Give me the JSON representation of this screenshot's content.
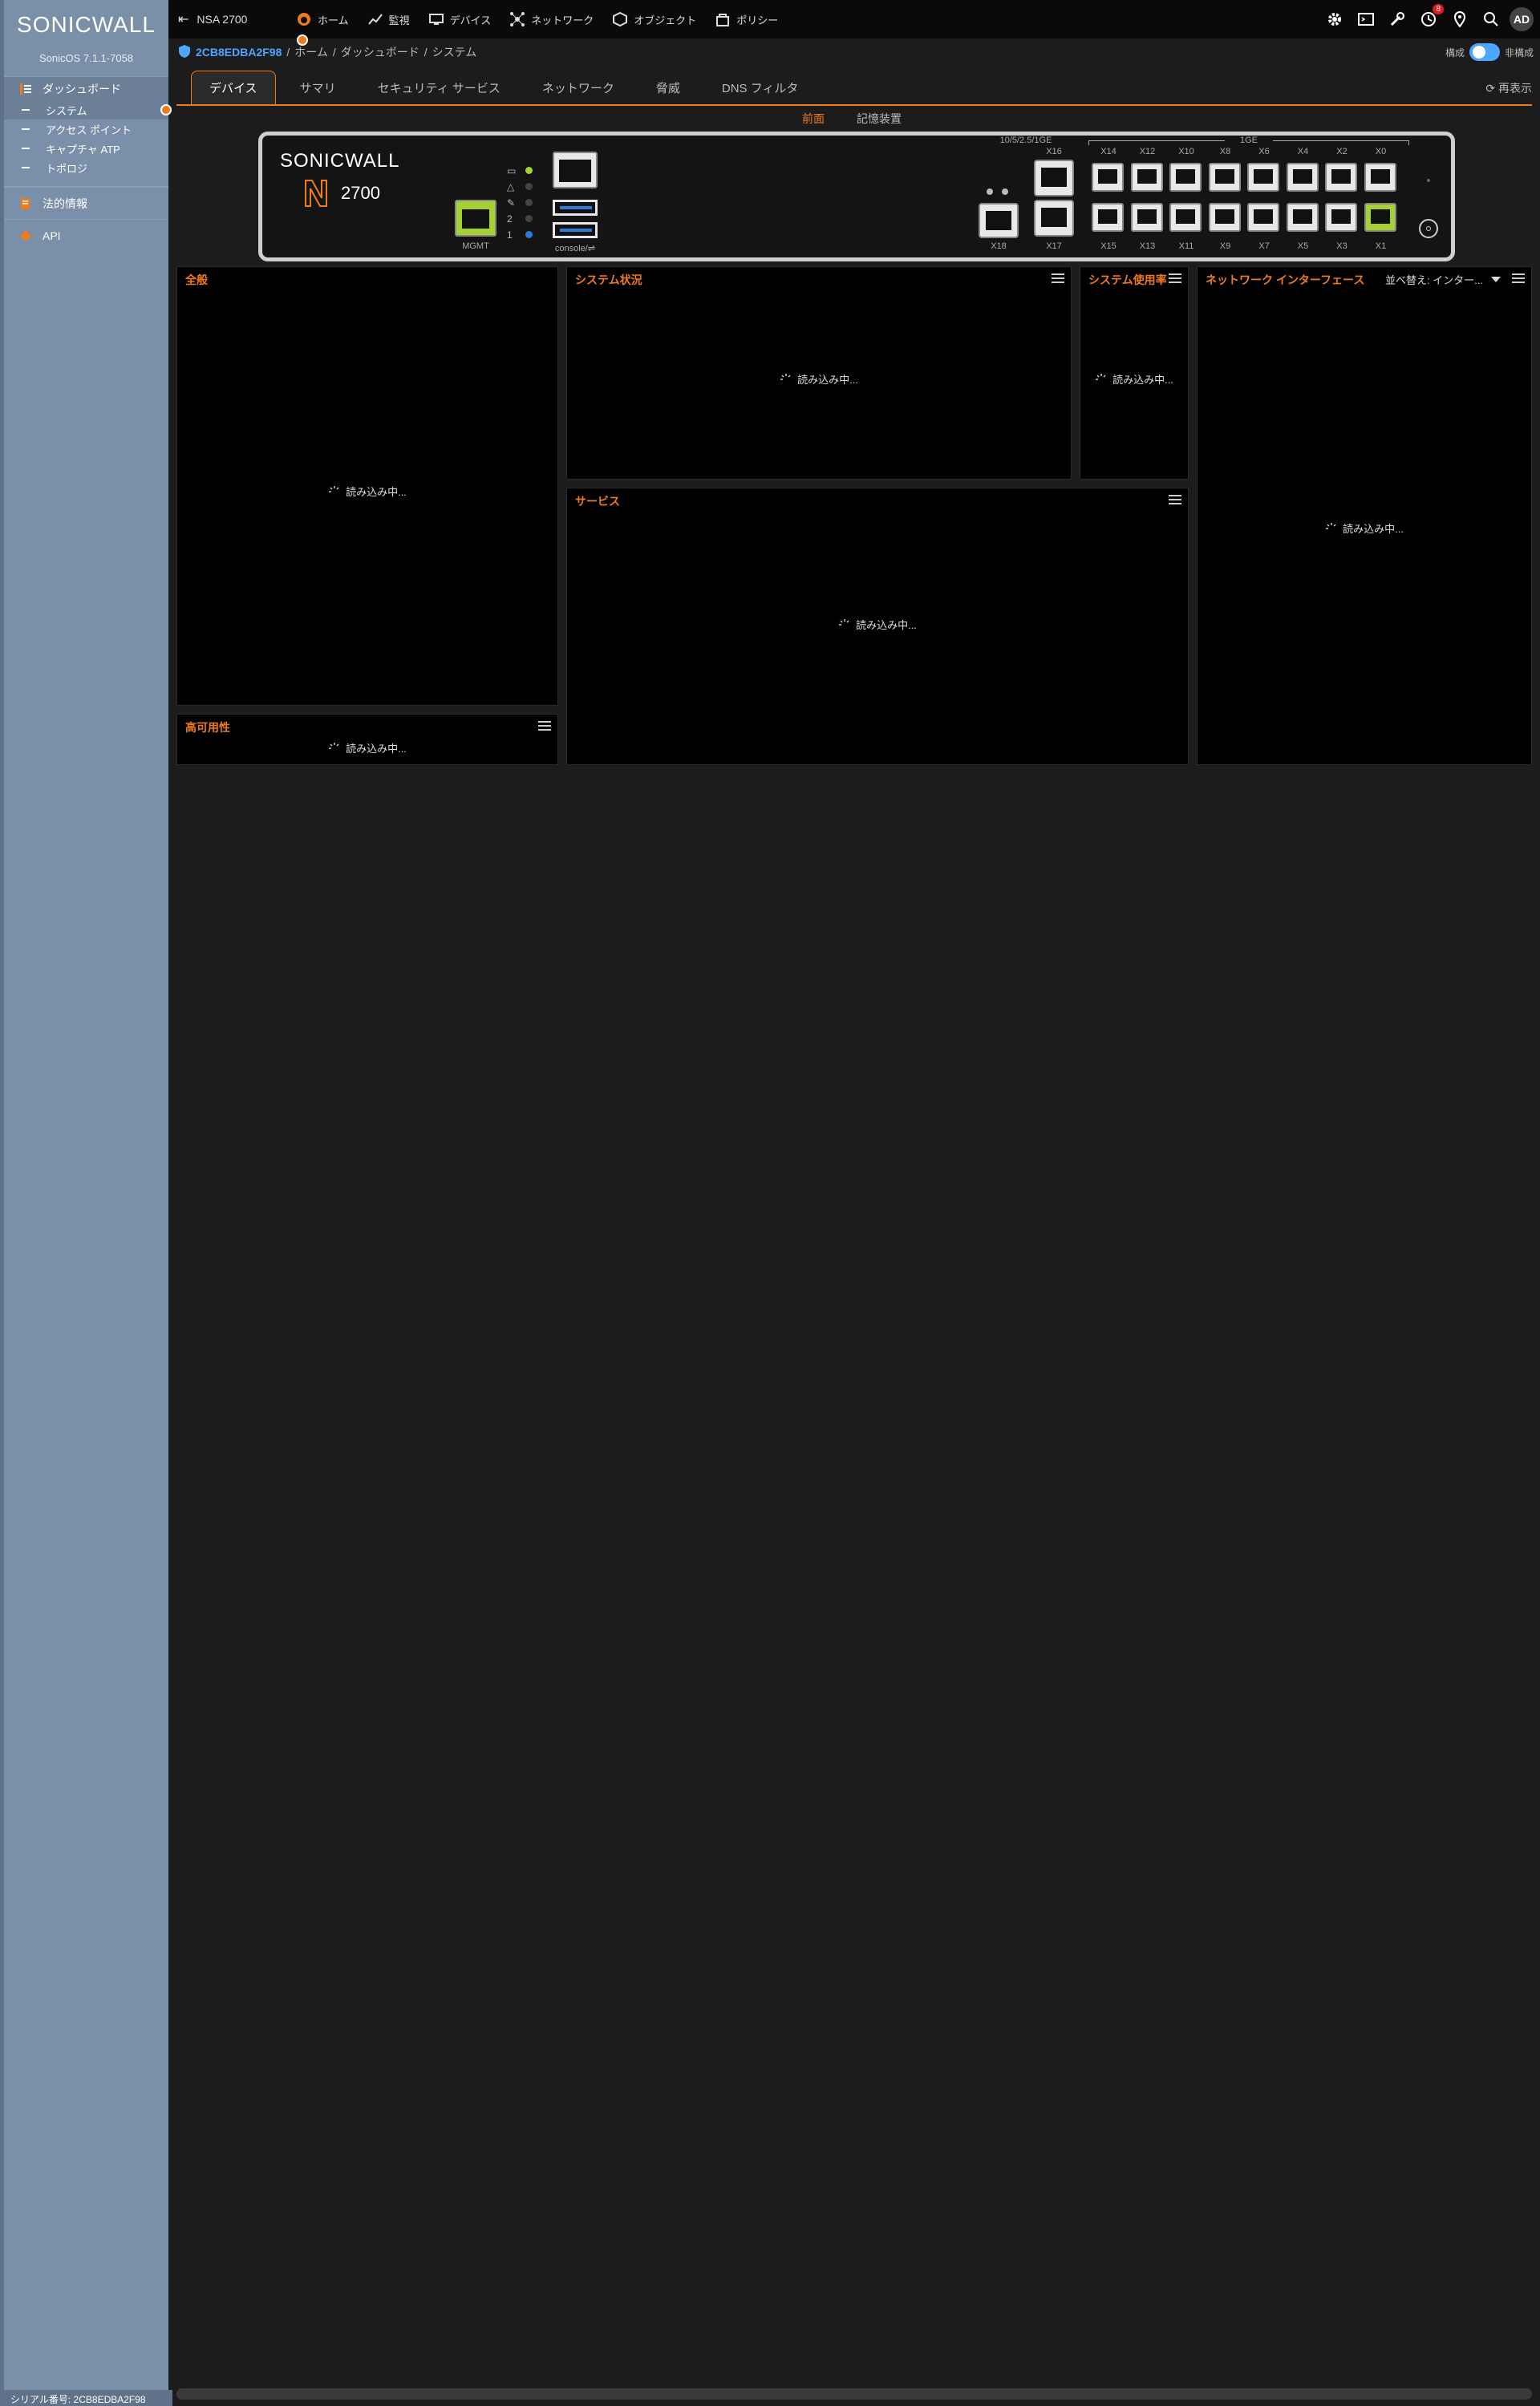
{
  "sidebar": {
    "logo": "SONICWALL",
    "version": "SonicOS 7.1.1-7058",
    "sections": [
      {
        "label": "ダッシュボード",
        "icon": "dashboard-icon"
      },
      {
        "label": "法的情報",
        "icon": "legal-icon"
      },
      {
        "label": "API",
        "icon": "api-icon"
      }
    ],
    "dashboard_items": [
      "システム",
      "アクセス ポイント",
      "キャプチャ ATP",
      "トポロジ"
    ],
    "active_item": "システム",
    "serial": "シリアル番号: 2CB8EDBA2F98"
  },
  "topbar": {
    "device_name": "NSA 2700",
    "nav": [
      "ホーム",
      "監視",
      "デバイス",
      "ネットワーク",
      "オブジェクト",
      "ポリシー"
    ],
    "notification_count": "8",
    "avatar": "AD"
  },
  "breadcrumb": {
    "serial": "2CB8EDBA2F98",
    "path": [
      "ホーム",
      "ダッシュボード",
      "システム"
    ],
    "toggle_left": "構成",
    "toggle_right": "非構成"
  },
  "tabs": [
    "デバイス",
    "サマリ",
    "セキュリティ サービス",
    "ネットワーク",
    "脅威",
    "DNS フィルタ"
  ],
  "refresh_label": "再表示",
  "subtabs": [
    "前面",
    "記憶装置"
  ],
  "device": {
    "brand": "SONICWALL",
    "model": "2700",
    "mgmt_label": "MGMT",
    "console_label": "console/",
    "led_labels": [
      "2",
      "1"
    ],
    "sfp_group_label": "10/5/2.5/1GE",
    "rj_group_label": "1GE",
    "top_ports": [
      "X14",
      "X12",
      "X10",
      "X8",
      "X6",
      "X4",
      "X2",
      "X0"
    ],
    "bottom_ports": [
      "X15",
      "X13",
      "X11",
      "X9",
      "X7",
      "X5",
      "X3",
      "X1"
    ],
    "x16": "X16",
    "x17": "X17",
    "x18": "X18"
  },
  "panels": {
    "general": {
      "title": "全般",
      "loading": "読み込み中..."
    },
    "system_status": {
      "title": "システム状況",
      "loading": "読み込み中..."
    },
    "system_usage": {
      "title": "システム使用率",
      "loading": "読み込み中..."
    },
    "network_interfaces": {
      "title": "ネットワーク インターフェース",
      "sort": "並べ替え: インター...",
      "loading": "読み込み中..."
    },
    "services": {
      "title": "サービス",
      "loading": "読み込み中..."
    },
    "ha": {
      "title": "高可用性",
      "loading": "読み込み中..."
    }
  },
  "colors": {
    "accent": "#f07b1a",
    "link": "#4da6ff",
    "port_active": "#a6d133"
  }
}
